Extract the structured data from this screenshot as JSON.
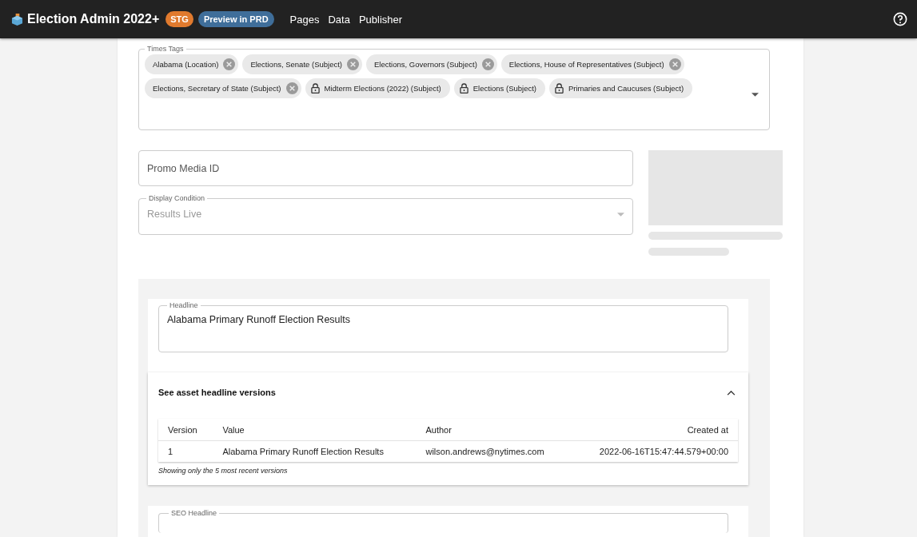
{
  "header": {
    "title": "Election Admin 2022+",
    "env_badge": "STG",
    "preview_button": "Preview in PRD",
    "nav": [
      {
        "label": "Pages"
      },
      {
        "label": "Data"
      },
      {
        "label": "Publisher"
      }
    ]
  },
  "times_tags": {
    "label": "Times Tags",
    "tags": [
      {
        "label": "Alabama (Location)",
        "kind": "removable"
      },
      {
        "label": "Elections, Senate (Subject)",
        "kind": "removable"
      },
      {
        "label": "Elections, Governors (Subject)",
        "kind": "removable"
      },
      {
        "label": "Elections, House of Representatives (Subject)",
        "kind": "removable"
      },
      {
        "label": "Elections, Secretary of State (Subject)",
        "kind": "removable"
      },
      {
        "label": "Midterm Elections (2022) (Subject)",
        "kind": "locked"
      },
      {
        "label": "Elections (Subject)",
        "kind": "locked"
      },
      {
        "label": "Primaries and Caucuses (Subject)",
        "kind": "locked"
      }
    ]
  },
  "promo_media": {
    "placeholder": "Promo Media ID"
  },
  "display_condition": {
    "label": "Display Condition",
    "value": "Results Live",
    "disabled": true
  },
  "headline": {
    "label": "Headline",
    "value": "Alabama Primary Runoff Election Results"
  },
  "versions": {
    "title": "See asset headline versions",
    "expanded": true,
    "columns": [
      "Version",
      "Value",
      "Author",
      "Created  at"
    ],
    "rows": [
      [
        "1",
        "Alabama Primary Runoff Election Results",
        "wilson.andrews@nytimes.com",
        "2022-06-16T15:47:44.579+00:00"
      ]
    ],
    "note": "Showing only the 5 most recent versions"
  },
  "seo_headline": {
    "label": "SEO Headline"
  }
}
